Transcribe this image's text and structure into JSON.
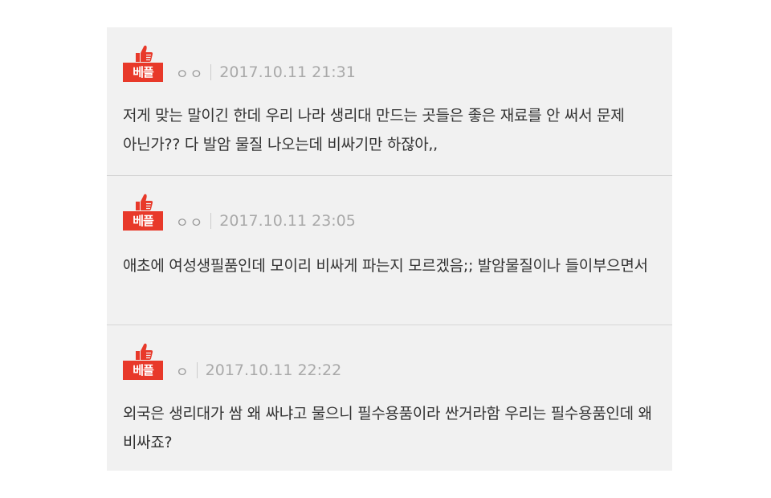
{
  "comments": [
    {
      "badge": "베플",
      "author": "ㅇㅇ",
      "date": "2017.10.11 21:31",
      "text": "저게 맞는 말이긴 한데 우리 나라 생리대 만드는 곳들은 좋은 재료를 안 써서 문제 아닌가?? 다 발암 물질 나오는데 비싸기만 하잖아,,"
    },
    {
      "badge": "베플",
      "author": "ㅇㅇ",
      "date": "2017.10.11 23:05",
      "text": "애초에 여성생필품인데 모이리 비싸게 파는지 모르겠음;; 발암물질이나 들이부으면서"
    },
    {
      "badge": "베플",
      "author": "ㅇ",
      "date": "2017.10.11 22:22",
      "text": "외국은 생리대가 쌈 왜 싸냐고 물으니 필수용품이라 싼거라함 우리는 필수용품인데 왜 비싸죠?"
    }
  ],
  "colors": {
    "badge_bg": "#e8392a",
    "panel_bg": "#f1f1f1",
    "text": "#333333",
    "meta": "#a9a9a9"
  },
  "icons": {
    "best_reply": "thumbs-up-icon"
  }
}
